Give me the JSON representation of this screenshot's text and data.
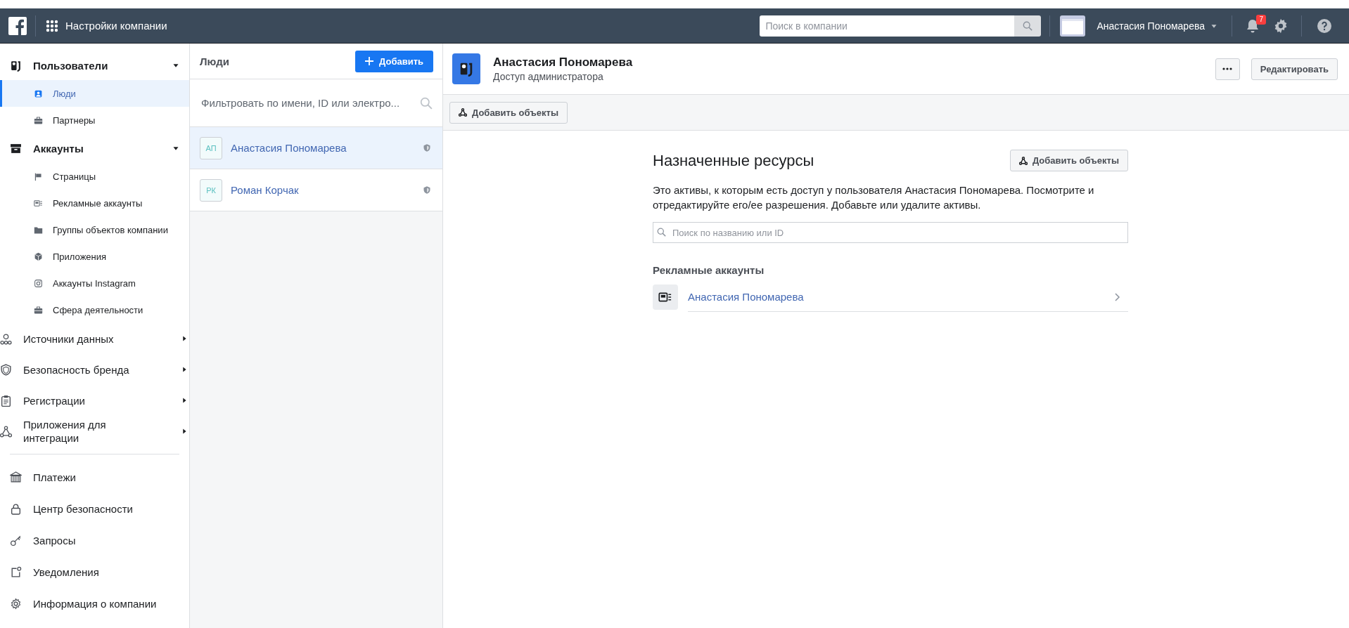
{
  "topbar": {
    "title": "Настройки компании",
    "search": {
      "placeholder": "Поиск в компании"
    },
    "user_name": "Анастасия Пономарева",
    "notifications_badge": "7"
  },
  "sidebar": {
    "groups": [
      {
        "label": "Пользователи",
        "expanded": true,
        "items": [
          {
            "label": "Люди",
            "selected": true
          },
          {
            "label": "Партнеры",
            "selected": false
          }
        ]
      },
      {
        "label": "Аккаунты",
        "expanded": true,
        "items": [
          {
            "label": "Страницы",
            "selected": false
          },
          {
            "label": "Рекламные аккаунты",
            "selected": false
          },
          {
            "label": "Группы объектов компании",
            "selected": false
          },
          {
            "label": "Приложения",
            "selected": false
          },
          {
            "label": "Аккаунты Instagram",
            "selected": false
          },
          {
            "label": "Сфера деятельности",
            "selected": false
          }
        ]
      },
      {
        "label": "Источники данных",
        "expanded": false
      },
      {
        "label": "Безопасность бренда",
        "expanded": false
      },
      {
        "label": "Регистрации",
        "expanded": false
      },
      {
        "label": "Приложения для интеграции",
        "expanded": false
      }
    ],
    "bottom_items": [
      {
        "label": "Платежи"
      },
      {
        "label": "Центр безопасности"
      },
      {
        "label": "Запросы"
      },
      {
        "label": "Уведомления"
      },
      {
        "label": "Информация о компании"
      }
    ]
  },
  "people": {
    "title": "Люди",
    "add_button": "Добавить",
    "filter": {
      "placeholder": "Фильтровать по имени, ID или электро..."
    },
    "items": [
      {
        "initials": "АП",
        "name": "Анастасия Пономарева",
        "selected": true
      },
      {
        "initials": "РК",
        "name": "Роман Корчак",
        "selected": false
      }
    ]
  },
  "detail": {
    "name": "Анастасия Пономарева",
    "role": "Доступ администратора",
    "edit_button": "Редактировать",
    "toolbar_button": "Добавить объекты"
  },
  "assets": {
    "title": "Назначенные ресурсы",
    "add_button": "Добавить объекты",
    "description": "Это активы, к которым есть доступ у пользователя Анастасия Пономарева. Посмотрите и отредактируйте его/ее разрешения. Добавьте или удалите активы.",
    "search": {
      "placeholder": "Поиск по названию или ID"
    },
    "sections": [
      {
        "title": "Рекламные аккаунты",
        "items": [
          {
            "name": "Анастасия Пономарева"
          }
        ]
      }
    ]
  }
}
